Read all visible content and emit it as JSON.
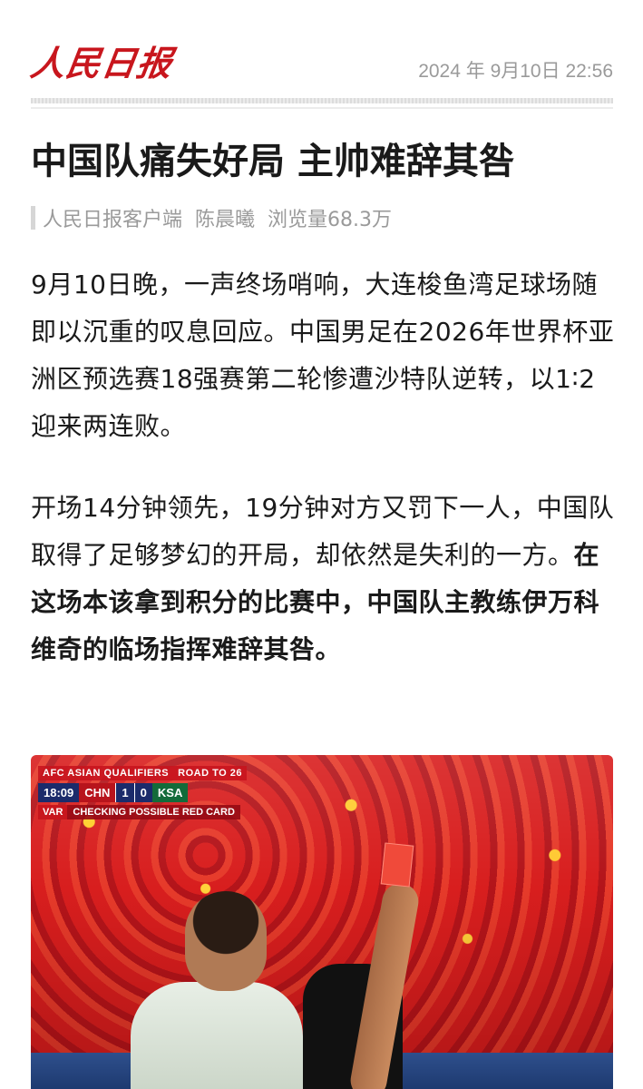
{
  "header": {
    "logo_text": "人民日报",
    "date": "2024 年 9月10日 22:56"
  },
  "article": {
    "title": "中国队痛失好局 主帅难辞其咎",
    "meta": {
      "source": "人民日报客户端",
      "author": "陈晨曦",
      "views": "浏览量68.3万"
    },
    "paragraph1": "9月10日晚，一声终场哨响，大连梭鱼湾足球场随即以沉重的叹息回应。中国男足在2026年世界杯亚洲区预选赛18强赛第二轮惨遭沙特队逆转，以1∶2迎来两连败。",
    "paragraph2_normal": "开场14分钟领先，19分钟对方又罚下一人，中国队取得了足够梦幻的开局，却依然是失利的一方。",
    "paragraph2_bold": "在这场本该拿到积分的比赛中，中国队主教练伊万科维奇的临场指挥难辞其咎。"
  },
  "photo": {
    "scoreboard": {
      "competition": "AFC ASIAN QUALIFIERS",
      "subtitle": "ROAD TO 26",
      "time": "18:09",
      "team1": "CHN",
      "score1": "1",
      "score2": "0",
      "team2": "KSA",
      "var_tag": "VAR",
      "var_text": "CHECKING POSSIBLE RED CARD"
    },
    "colors": {
      "crowd": "#c8181c",
      "accent": "#c8161d"
    }
  }
}
